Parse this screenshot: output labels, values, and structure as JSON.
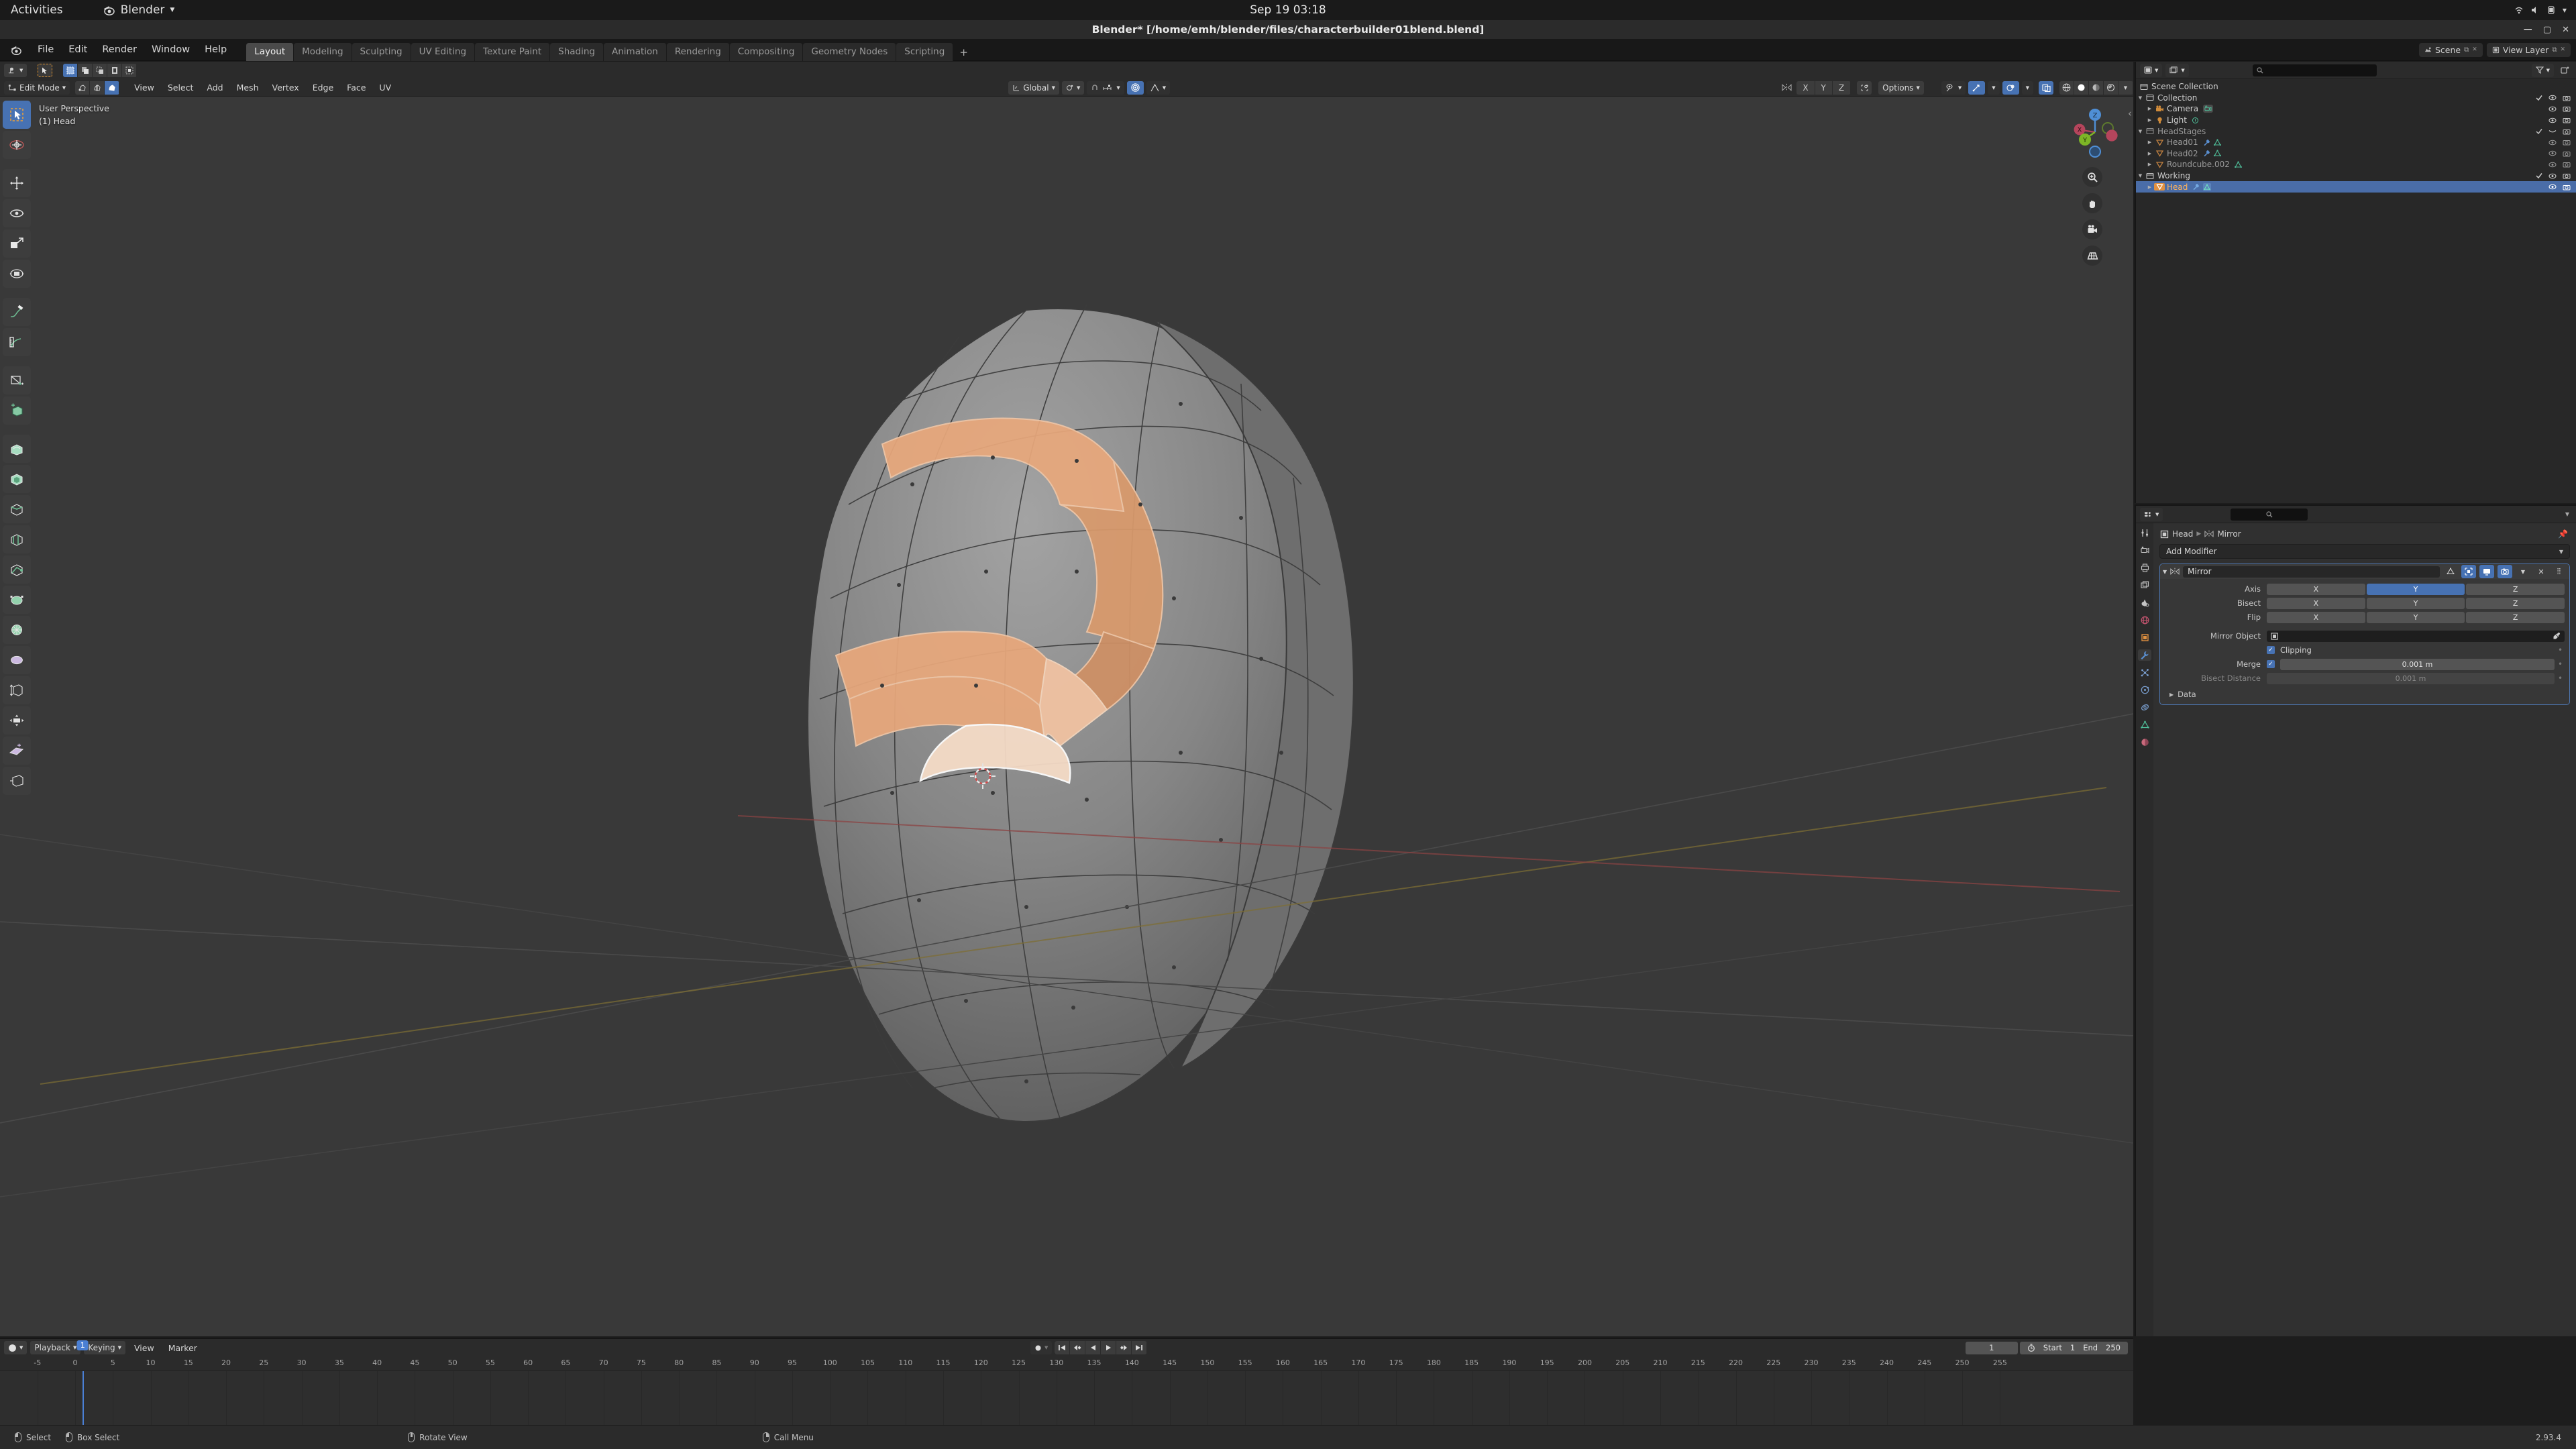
{
  "gnome": {
    "activities": "Activities",
    "app_name": "Blender",
    "clock": "Sep 19  03:18"
  },
  "window": {
    "title": "Blender* [/home/emh/blender/files/characterbuilder01blend.blend]"
  },
  "topbar": {
    "menus": [
      "File",
      "Edit",
      "Render",
      "Window",
      "Help"
    ],
    "workspaces": [
      {
        "label": "Layout",
        "active": true
      },
      {
        "label": "Modeling",
        "active": false
      },
      {
        "label": "Sculpting",
        "active": false
      },
      {
        "label": "UV Editing",
        "active": false
      },
      {
        "label": "Texture Paint",
        "active": false
      },
      {
        "label": "Shading",
        "active": false
      },
      {
        "label": "Animation",
        "active": false
      },
      {
        "label": "Rendering",
        "active": false
      },
      {
        "label": "Compositing",
        "active": false
      },
      {
        "label": "Geometry Nodes",
        "active": false
      },
      {
        "label": "Scripting",
        "active": false
      }
    ],
    "add_workspace": "+",
    "scene_name": "Scene",
    "view_layer_name": "View Layer"
  },
  "viewport": {
    "mode": "Edit Mode",
    "menus": [
      "View",
      "Select",
      "Add",
      "Mesh",
      "Vertex",
      "Edge",
      "Face",
      "UV"
    ],
    "transform_orientation": "Global",
    "options_label": "Options",
    "mirror_axes": [
      "X",
      "Y",
      "Z"
    ],
    "overlay_line1": "User Perspective",
    "overlay_line2": "(1) Head",
    "gizmo_axes": [
      "X",
      "Y",
      "Z"
    ]
  },
  "outliner": {
    "search_placeholder": "",
    "rows": [
      {
        "label": "Scene Collection",
        "icon": "collection-icon",
        "indent": 0,
        "tri": "",
        "selected": false,
        "dim": false,
        "eye": false,
        "cam": false,
        "check": false,
        "badges": []
      },
      {
        "label": "Collection",
        "icon": "collection-icon",
        "indent": 1,
        "tri": "down",
        "selected": false,
        "dim": false,
        "eye": true,
        "cam": true,
        "check": true,
        "badges": []
      },
      {
        "label": "Camera",
        "icon": "camera-icon",
        "indent": 2,
        "tri": "right",
        "selected": false,
        "dim": false,
        "eye": true,
        "cam": true,
        "check": false,
        "badges": [
          "camera-data-icon"
        ]
      },
      {
        "label": "Light",
        "icon": "light-icon",
        "indent": 2,
        "tri": "right",
        "selected": false,
        "dim": false,
        "eye": true,
        "cam": true,
        "check": false,
        "badges": [
          "light-data-icon"
        ]
      },
      {
        "label": "HeadStages",
        "icon": "collection-icon",
        "indent": 1,
        "tri": "down",
        "selected": false,
        "dim": true,
        "eye": false,
        "cam": true,
        "check": true,
        "badges": []
      },
      {
        "label": "Head01",
        "icon": "mesh-object-icon",
        "indent": 2,
        "tri": "right",
        "selected": false,
        "dim": true,
        "eye": true,
        "cam": true,
        "check": false,
        "badges": [
          "modifier-icon",
          "mesh-data-icon"
        ]
      },
      {
        "label": "Head02",
        "icon": "mesh-object-icon",
        "indent": 2,
        "tri": "right",
        "selected": false,
        "dim": true,
        "eye": true,
        "cam": true,
        "check": false,
        "badges": [
          "modifier-icon",
          "mesh-data-icon"
        ]
      },
      {
        "label": "Roundcube.002",
        "icon": "mesh-object-icon",
        "indent": 2,
        "tri": "right",
        "selected": false,
        "dim": true,
        "eye": true,
        "cam": true,
        "check": false,
        "badges": [
          "mesh-data-icon"
        ]
      },
      {
        "label": "Working",
        "icon": "collection-icon",
        "indent": 1,
        "tri": "down",
        "selected": false,
        "dim": false,
        "eye": true,
        "cam": true,
        "check": true,
        "badges": []
      },
      {
        "label": "Head",
        "icon": "mesh-object-icon",
        "indent": 2,
        "tri": "right",
        "selected": true,
        "dim": false,
        "eye": true,
        "cam": true,
        "check": false,
        "badges": [
          "modifier-icon",
          "mesh-data-icon"
        ]
      }
    ]
  },
  "properties": {
    "search_placeholder": "",
    "breadcrumb_object": "Head",
    "breadcrumb_modifier": "Mirror",
    "add_modifier_label": "Add Modifier",
    "modifier": {
      "name": "Mirror",
      "axis_label": "Axis",
      "axis_options": [
        "X",
        "Y",
        "Z"
      ],
      "axis_active": "Y",
      "bisect_label": "Bisect",
      "bisect_options": [
        "X",
        "Y",
        "Z"
      ],
      "bisect_active": "",
      "flip_label": "Flip",
      "flip_options": [
        "X",
        "Y",
        "Z"
      ],
      "flip_active": "",
      "mirror_object_label": "Mirror Object",
      "mirror_object_value": "",
      "clipping_label": "Clipping",
      "clipping_checked": true,
      "merge_label": "Merge",
      "merge_checked": true,
      "merge_value": "0.001 m",
      "bisect_distance_label": "Bisect Distance",
      "bisect_distance_value": "0.001 m",
      "data_label": "Data"
    }
  },
  "timeline": {
    "editor_menus": [
      "Playback",
      "Keying",
      "View",
      "Marker"
    ],
    "current_frame": "1",
    "start_label": "Start",
    "start_value": "1",
    "end_label": "End",
    "end_value": "250",
    "ticks": [
      "-5",
      "0",
      "5",
      "10",
      "15",
      "20",
      "25",
      "30",
      "35",
      "40",
      "45",
      "50",
      "55",
      "60",
      "65",
      "70",
      "75",
      "80",
      "85",
      "90",
      "95",
      "100",
      "105",
      "110",
      "115",
      "120",
      "125",
      "130",
      "135",
      "140",
      "145",
      "150",
      "155",
      "160",
      "165",
      "170",
      "175",
      "180",
      "185",
      "190",
      "195",
      "200",
      "205",
      "210",
      "215",
      "220",
      "225",
      "230",
      "235",
      "240",
      "245",
      "250",
      "255"
    ],
    "playhead_label": "1"
  },
  "statusbar": {
    "items": [
      {
        "label": "Select",
        "mouse": "left"
      },
      {
        "label": "Box Select",
        "mouse": "left-drag"
      },
      {
        "label": "Rotate View",
        "mouse": "middle"
      },
      {
        "label": "Call Menu",
        "mouse": "right"
      }
    ],
    "version": "2.93.4"
  },
  "colors": {
    "accent_blue": "#4772b3",
    "selection_orange": "#e8a87c",
    "viewport_bg": "#393939",
    "panel_bg": "#303030",
    "header_bg": "#2b2b2b"
  }
}
